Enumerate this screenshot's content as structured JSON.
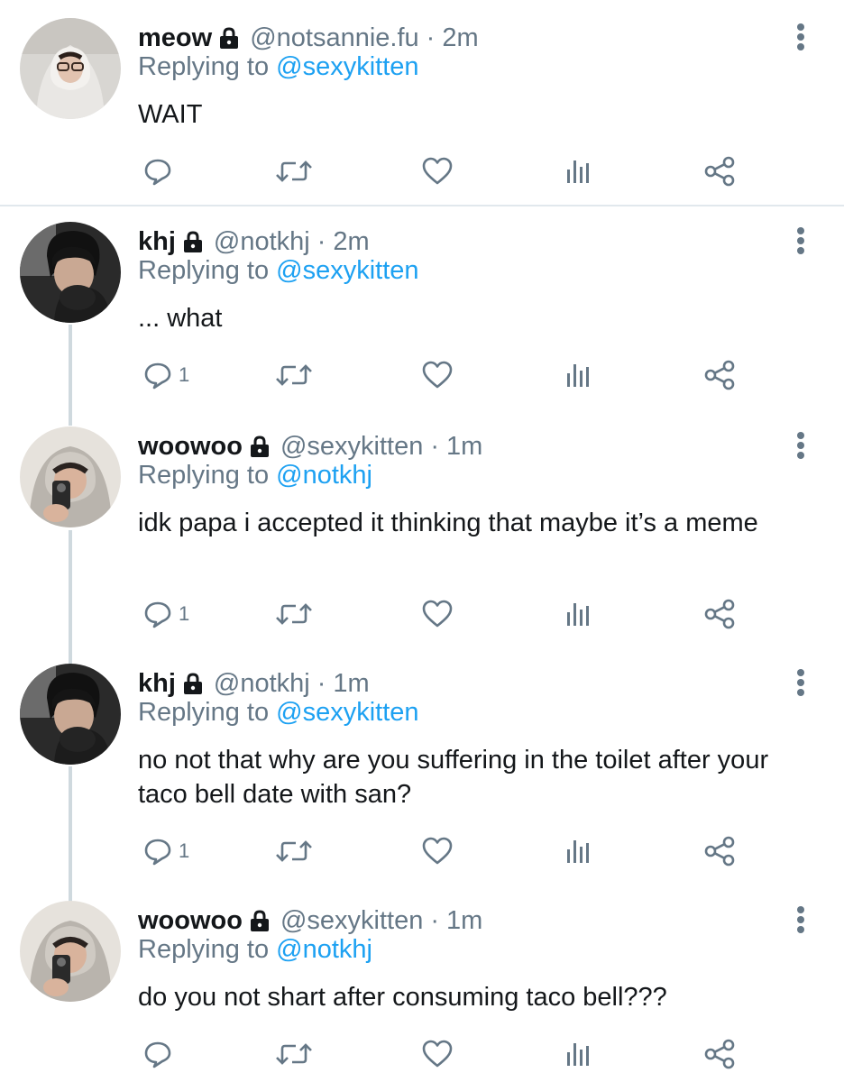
{
  "tweets": [
    {
      "name": "meow",
      "handle": "@notsannie.fu",
      "separator": "·",
      "time": "2m",
      "replying_prefix": "Replying to",
      "replying_to": "@sexykitten",
      "text": "WAIT",
      "reply_count": "",
      "avatar": "person-in-hoodie-with-glasses"
    },
    {
      "name": "khj",
      "handle": "@notkhj",
      "separator": "·",
      "time": "2m",
      "replying_prefix": "Replying to",
      "replying_to": "@sexykitten",
      "text": "... what",
      "reply_count": "1",
      "avatar": "person-in-car-dark"
    },
    {
      "name": "woowoo",
      "handle": "@sexykitten",
      "separator": "·",
      "time": "1m",
      "replying_prefix": "Replying to",
      "replying_to": "@notkhj",
      "text": "idk papa i accepted it thinking that maybe it’s a meme",
      "reply_count": "1",
      "avatar": "person-in-grey-hoodie-mirror-selfie"
    },
    {
      "name": "khj",
      "handle": "@notkhj",
      "separator": "·",
      "time": "1m",
      "replying_prefix": "Replying to",
      "replying_to": "@sexykitten",
      "text": "no not that why are you suffering in the toilet after your taco bell date with san?",
      "reply_count": "1",
      "avatar": "person-in-car-dark"
    },
    {
      "name": "woowoo",
      "handle": "@sexykitten",
      "separator": "·",
      "time": "1m",
      "replying_prefix": "Replying to",
      "replying_to": "@notkhj",
      "text": "do you not shart after consuming taco bell???",
      "reply_count": "",
      "avatar": "person-in-grey-hoodie-mirror-selfie"
    }
  ],
  "icons": {
    "reply": "reply-icon",
    "retweet": "retweet-icon",
    "like": "heart-icon",
    "analytics": "analytics-icon",
    "share": "share-icon",
    "more": "more-options-icon",
    "lock": "lock-icon"
  },
  "colors": {
    "text": "#14171a",
    "muted": "#657786",
    "link": "#1da1f2",
    "divider": "#e1e8ed",
    "thread_line": "#cfd9de"
  }
}
